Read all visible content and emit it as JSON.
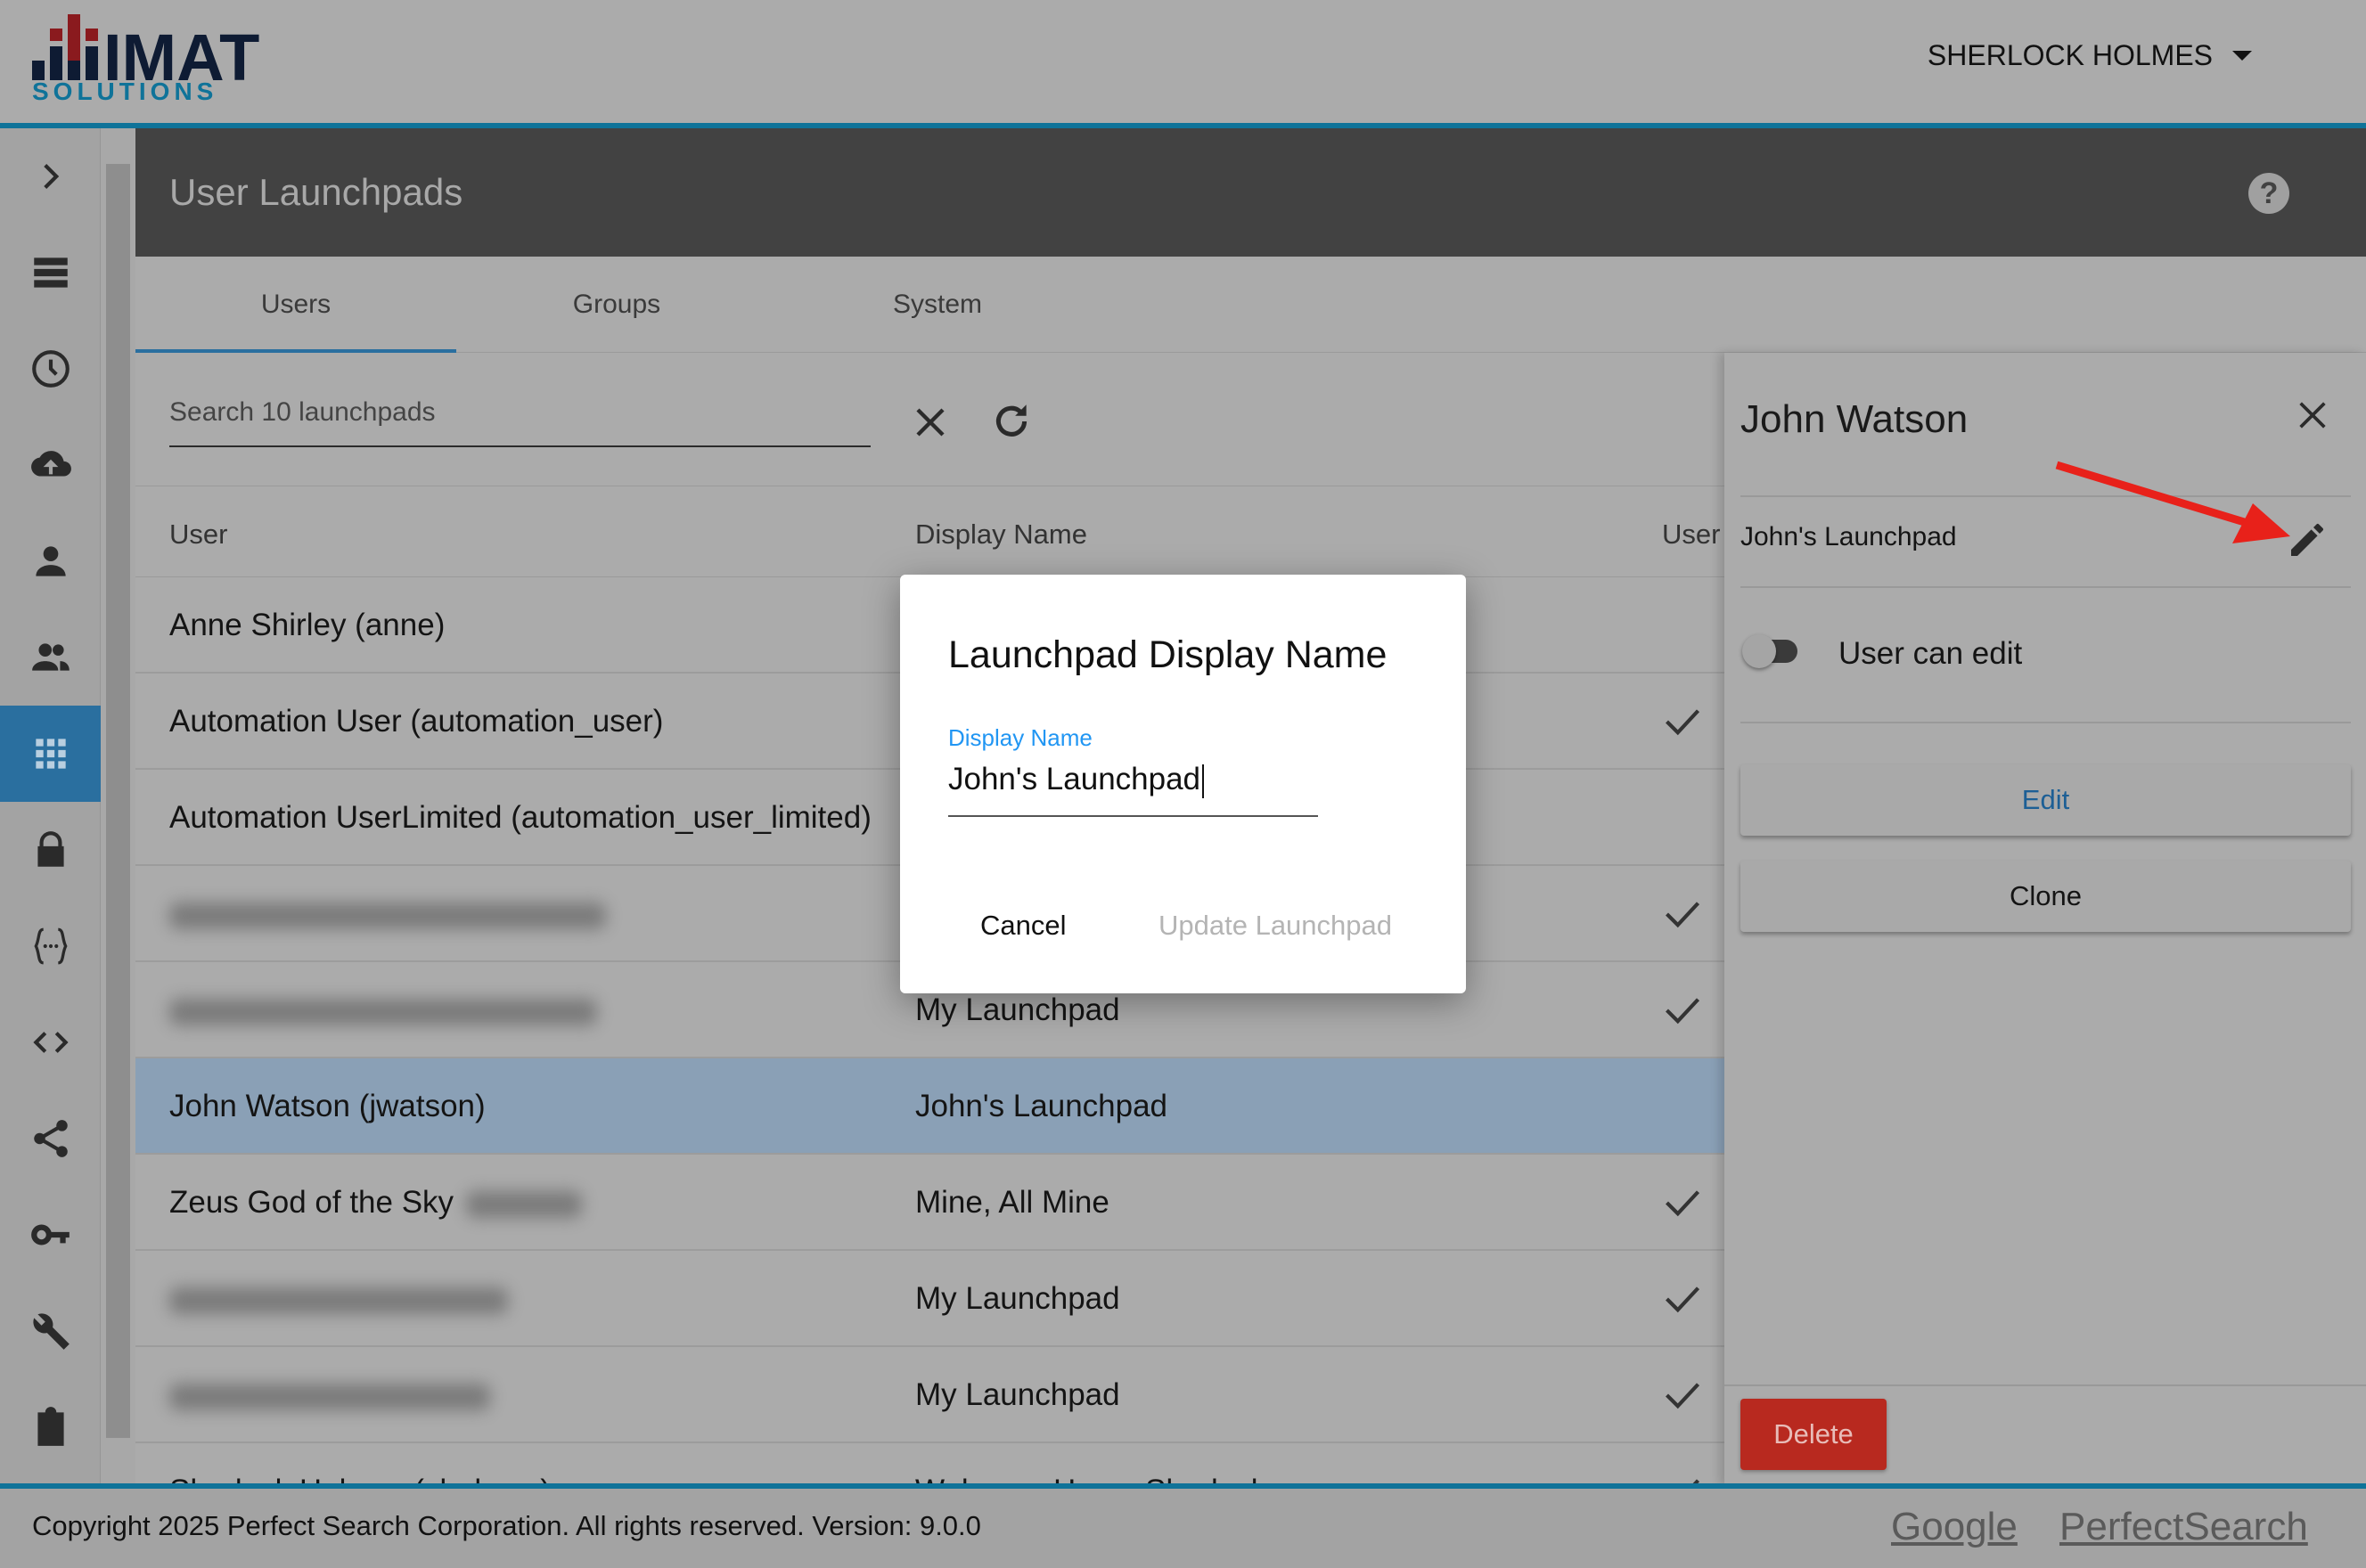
{
  "header": {
    "logo_text": "IMAT SOLUTIONS",
    "user": "SHERLOCK HOLMES"
  },
  "colors": {
    "accent": "#0f7399",
    "selected_nav": "#2a6f9f",
    "delete": "#b8291f",
    "label_blue": "#2196f3"
  },
  "sidebar": {
    "items": [
      "expand-icon",
      "list-icon",
      "history-icon",
      "cloud-upload-icon",
      "person-icon",
      "group-icon",
      "apps-icon",
      "lock-icon",
      "braces-icon",
      "code-icon",
      "share-icon",
      "key-icon",
      "wrench-icon",
      "clipboard-check-icon"
    ],
    "active": "apps-icon"
  },
  "page": {
    "title": "User Launchpads"
  },
  "tabs": [
    {
      "label": "Users"
    },
    {
      "label": "Groups"
    },
    {
      "label": "System"
    }
  ],
  "search": {
    "placeholder": "Search 10 launchpads"
  },
  "table": {
    "headers": [
      "User",
      "Display Name",
      "User can edit"
    ],
    "rows": [
      {
        "user": "Anne Shirley (anne)",
        "display": "",
        "check": false
      },
      {
        "user": "Automation User (automation_user)",
        "display": "",
        "check": true
      },
      {
        "user": "Automation UserLimited (automation_user_limited)",
        "display": "",
        "check": false
      },
      {
        "user": "",
        "display": "",
        "check": true,
        "blurred": true
      },
      {
        "user": "",
        "display": "My Launchpad",
        "check": true,
        "blurred": true
      },
      {
        "user": "John Watson (jwatson)",
        "display": "John's Launchpad",
        "check": false,
        "selected": true
      },
      {
        "user": "Zeus God of the Sky",
        "display": "Mine, All Mine",
        "check": true,
        "partial_blur": true
      },
      {
        "user": "",
        "display": "My Launchpad",
        "check": true,
        "blurred": true
      },
      {
        "user": "",
        "display": "My Launchpad",
        "check": true,
        "blurred": true
      },
      {
        "user": "Sherlock Holmes (sholmes)",
        "display": "Welcome Home Sherlock",
        "check": true
      }
    ]
  },
  "panel": {
    "title": "John Watson",
    "launchpad_name": "John's Launchpad",
    "toggle_label": "User can edit",
    "toggle_on": false,
    "edit": "Edit",
    "clone": "Clone",
    "delete": "Delete"
  },
  "dialog": {
    "title": "Launchpad Display Name",
    "field_label": "Display Name",
    "field_value": "John's Launchpad",
    "cancel": "Cancel",
    "update": "Update Launchpad"
  },
  "footer": {
    "copyright": "Copyright 2025 Perfect Search Corporation. All rights reserved. Version: 9.0.0",
    "links": [
      "Google",
      "PerfectSearch"
    ]
  }
}
